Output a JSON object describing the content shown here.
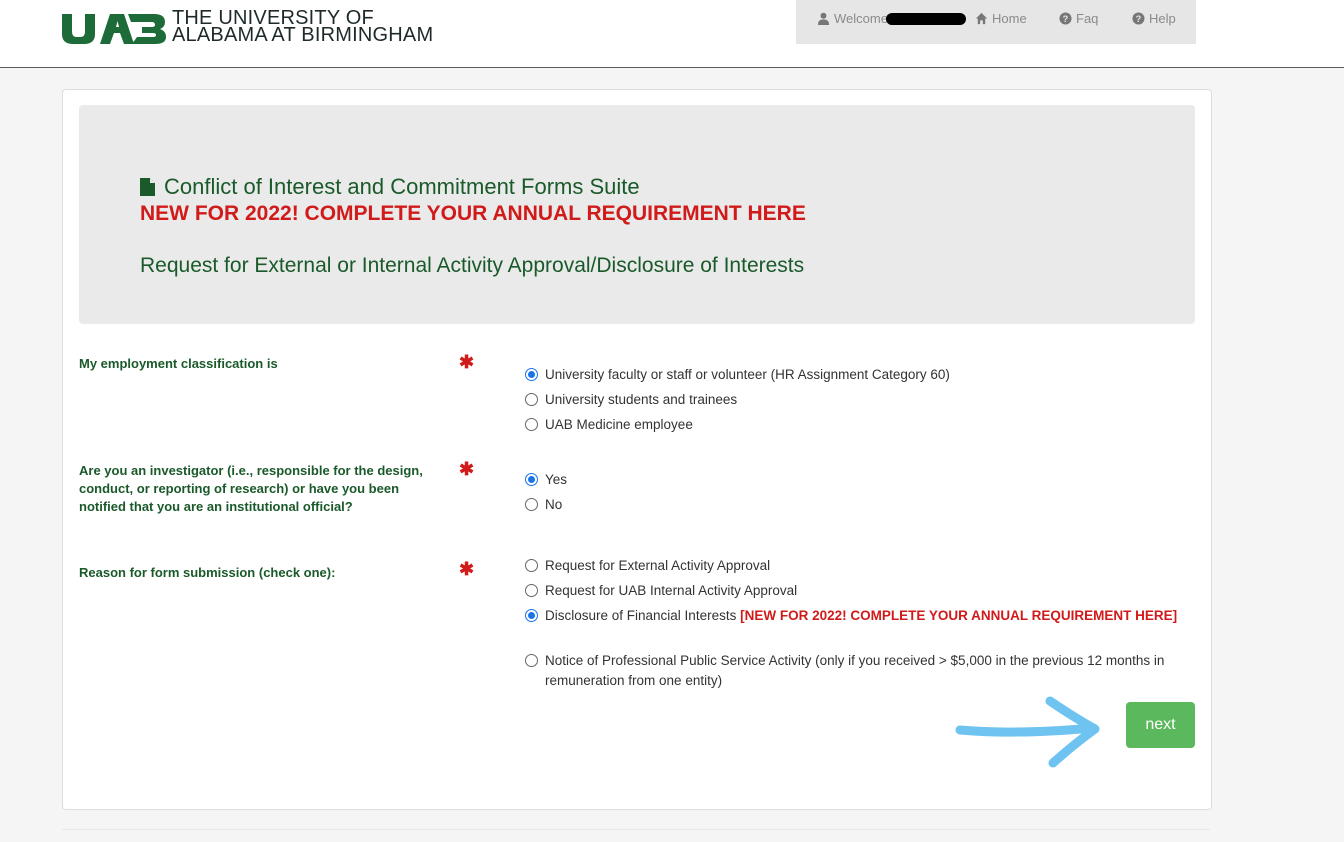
{
  "header": {
    "logo_line1": "THE UNIVERSITY OF",
    "logo_line2": "ALABAMA AT BIRMINGHAM"
  },
  "usernav": {
    "welcome": "Welcome",
    "home": "Home",
    "faq": "Faq",
    "help": "Help"
  },
  "hero": {
    "title": "Conflict of Interest and Commitment Forms Suite",
    "notice": "NEW FOR 2022! COMPLETE YOUR ANNUAL REQUIREMENT HERE",
    "subtitle": "Request for External or Internal Activity Approval/Disclosure of Interests"
  },
  "questions": {
    "employment": {
      "label": "My employment classification is",
      "required": "✱",
      "options": [
        "University faculty or staff or volunteer (HR Assignment Category 60)",
        "University students and trainees",
        "UAB Medicine employee"
      ]
    },
    "investigator": {
      "label": "Are you an investigator (i.e., responsible for the design, conduct, or reporting of research) or have you been notified that you are an institutional official?",
      "required": "✱",
      "options": [
        "Yes",
        "No"
      ]
    },
    "reason": {
      "label": "Reason for form submission (check one):",
      "required": "✱",
      "options": [
        "Request for External Activity Approval",
        "Request for UAB Internal Activity Approval",
        "Disclosure of Financial Interests",
        "Notice of Professional Public Service Activity (only if you received > $5,000 in the previous 12 months in remuneration from one entity)"
      ],
      "inline_notice": "[NEW FOR 2022! COMPLETE YOUR ANNUAL REQUIREMENT HERE]"
    }
  },
  "actions": {
    "next": "next"
  },
  "colors": {
    "brand_green": "#1a5a2a",
    "alert_red": "#d11a1a",
    "button_green": "#5cb85c",
    "annotation_arrow": "#6ec3f0"
  }
}
